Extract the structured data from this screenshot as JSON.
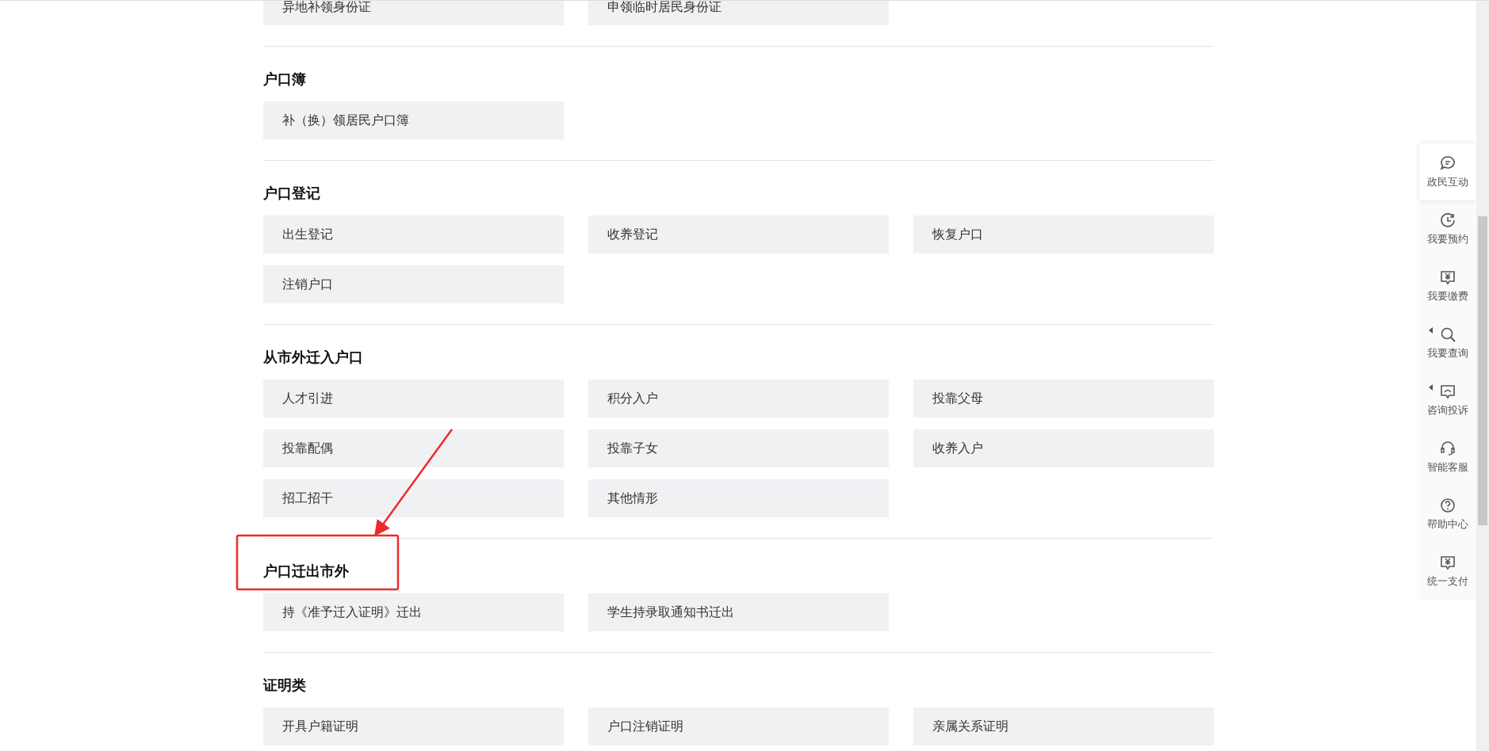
{
  "sections": [
    {
      "items": [
        "异地补领身份证",
        "申领临时居民身份证"
      ]
    },
    {
      "heading": "户口簿",
      "items": [
        "补（换）领居民户口簿"
      ]
    },
    {
      "heading": "户口登记",
      "items": [
        "出生登记",
        "收养登记",
        "恢复户口",
        "注销户口"
      ]
    },
    {
      "heading": "从市外迁入户口",
      "items": [
        "人才引进",
        "积分入户",
        "投靠父母",
        "投靠配偶",
        "投靠子女",
        "收养入户",
        "招工招干",
        "其他情形"
      ]
    },
    {
      "heading": "户口迁出市外",
      "highlighted": true,
      "items": [
        "持《准予迁入证明》迁出",
        "学生持录取通知书迁出"
      ]
    },
    {
      "heading": "证明类",
      "items": [
        "开具户籍证明",
        "户口注销证明",
        "亲属关系证明"
      ]
    }
  ],
  "sidebar": [
    {
      "label": "政民互动",
      "selected": true,
      "flyout": false
    },
    {
      "label": "我要预约",
      "selected": false,
      "flyout": false
    },
    {
      "label": "我要缴费",
      "selected": false,
      "flyout": false
    },
    {
      "label": "我要查询",
      "selected": false,
      "flyout": true
    },
    {
      "label": "咨询投诉",
      "selected": false,
      "flyout": true
    },
    {
      "label": "智能客服",
      "selected": false,
      "flyout": false
    },
    {
      "label": "帮助中心",
      "selected": false,
      "flyout": false
    },
    {
      "label": "统一支付",
      "selected": false,
      "flyout": false
    }
  ]
}
